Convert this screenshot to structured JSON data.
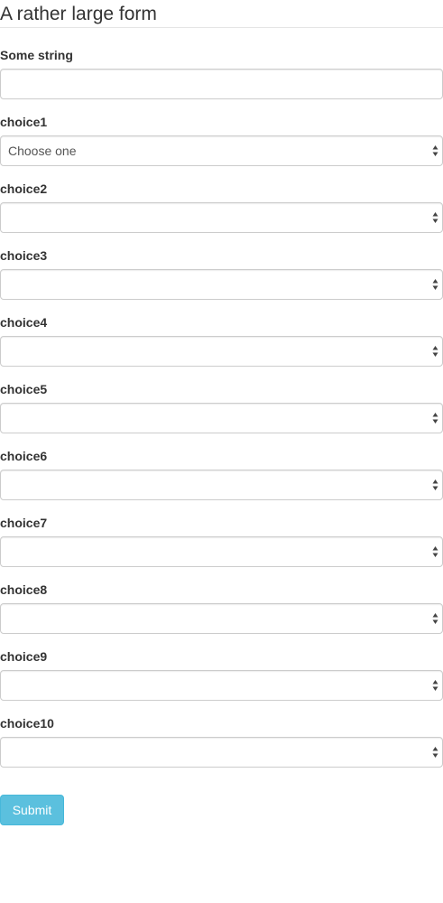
{
  "form": {
    "title": "A rather large form",
    "string_field": {
      "label": "Some string",
      "value": "",
      "placeholder": ""
    },
    "choices": [
      {
        "label": "choice1",
        "selected": "Choose one"
      },
      {
        "label": "choice2",
        "selected": ""
      },
      {
        "label": "choice3",
        "selected": ""
      },
      {
        "label": "choice4",
        "selected": ""
      },
      {
        "label": "choice5",
        "selected": ""
      },
      {
        "label": "choice6",
        "selected": ""
      },
      {
        "label": "choice7",
        "selected": ""
      },
      {
        "label": "choice8",
        "selected": ""
      },
      {
        "label": "choice9",
        "selected": ""
      },
      {
        "label": "choice10",
        "selected": ""
      }
    ],
    "submit_label": "Submit"
  },
  "colors": {
    "submit_background": "#5bc0de",
    "submit_border": "#46b8da",
    "input_border": "#cccccc",
    "text": "#333333"
  },
  "icons": {
    "select_arrow": "updown-arrows-icon"
  }
}
